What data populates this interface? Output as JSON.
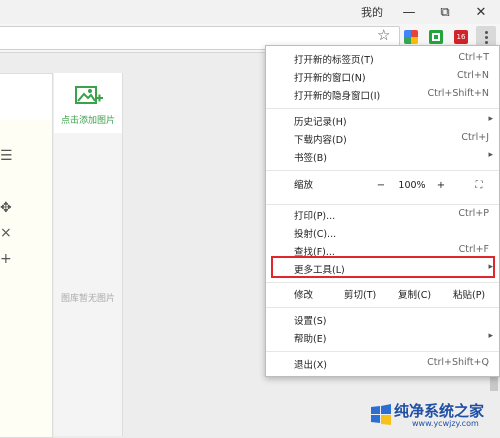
{
  "titlebar": {
    "user": "我的",
    "minimize": "—",
    "restore": "⧉",
    "close": "✕"
  },
  "toolbar": {
    "star": "☆",
    "ext3_label": "16"
  },
  "page": {
    "add_image_label": "点击添加图片",
    "empty_label": "图库暂无图片",
    "left_symbols": [
      "☰",
      "✥",
      "×",
      "+"
    ]
  },
  "menu": {
    "new_tab": {
      "label": "打开新的标签页(T)",
      "shortcut": "Ctrl+T"
    },
    "new_window": {
      "label": "打开新的窗口(N)",
      "shortcut": "Ctrl+N"
    },
    "incognito": {
      "label": "打开新的隐身窗口(I)",
      "shortcut": "Ctrl+Shift+N"
    },
    "history": {
      "label": "历史记录(H)"
    },
    "downloads": {
      "label": "下载内容(D)",
      "shortcut": "Ctrl+J"
    },
    "bookmarks": {
      "label": "书签(B)"
    },
    "zoom": {
      "label": "缩放",
      "minus": "−",
      "value": "100%",
      "plus": "+",
      "fullscreen": "⛶"
    },
    "print": {
      "label": "打印(P)...",
      "shortcut": "Ctrl+P"
    },
    "cast": {
      "label": "投射(C)..."
    },
    "find": {
      "label": "查找(F)...",
      "shortcut": "Ctrl+F"
    },
    "more_tools": {
      "label": "更多工具(L)"
    },
    "edit": {
      "label": "修改",
      "cut": "剪切(T)",
      "copy": "复制(C)",
      "paste": "粘贴(P)"
    },
    "settings": {
      "label": "设置(S)"
    },
    "help": {
      "label": "帮助(E)"
    },
    "exit": {
      "label": "退出(X)",
      "shortcut": "Ctrl+Shift+Q"
    },
    "submenu_arrow": "▸"
  },
  "watermark": {
    "title": "纯净系统之家",
    "url": "www.ycwjzy.com"
  },
  "colors": {
    "highlight": "#e0272b",
    "accent_green": "#3aa24a"
  }
}
